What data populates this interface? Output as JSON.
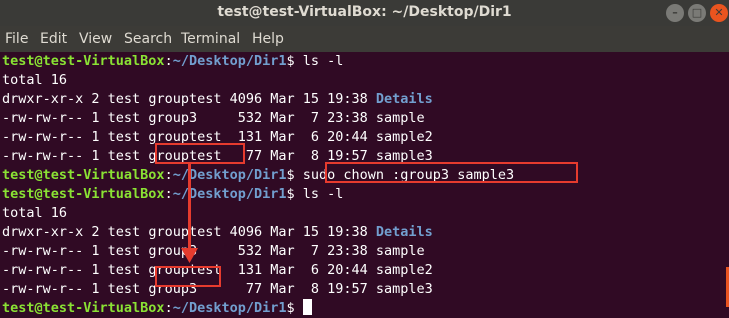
{
  "window": {
    "title": "test@test-VirtualBox: ~/Desktop/Dir1",
    "min_glyph": "–",
    "max_glyph": "□",
    "close_glyph": "✕"
  },
  "menu": [
    "File",
    "Edit",
    "View",
    "Search",
    "Terminal",
    "Help"
  ],
  "prompt": {
    "user": "test@test-VirtualBox",
    "sep": ":",
    "path": "~/Desktop/Dir1",
    "symbol": "$ "
  },
  "commands": {
    "ls1": "ls -l",
    "chown": "sudo chown :group3 sample3",
    "ls2": "ls -l"
  },
  "listing1": {
    "total": "total 16",
    "rows": [
      {
        "prefix": "drwxr-xr-x 2 test ",
        "group": "grouptest",
        "rest": " 4096 Mar 15 19:38 ",
        "name": "Details"
      },
      {
        "prefix": "-rw-rw-r-- 1 test ",
        "group": "group3   ",
        "rest": "  532 Mar  7 23:38 ",
        "name": "sample"
      },
      {
        "prefix": "-rw-rw-r-- 1 test ",
        "group": "grouptest",
        "rest": "  131 Mar  6 20:44 ",
        "name": "sample2"
      },
      {
        "prefix": "-rw-rw-r-- 1 test ",
        "group": "grouptest",
        "rest": "   77 Mar  8 19:57 ",
        "name": "sample3"
      }
    ]
  },
  "listing2": {
    "total": "total 16",
    "rows": [
      {
        "prefix": "drwxr-xr-x 2 test ",
        "group": "grouptest",
        "rest": " 4096 Mar 15 19:38 ",
        "name": "Details"
      },
      {
        "prefix": "-rw-rw-r-- 1 test ",
        "group": "group3   ",
        "rest": "  532 Mar  7 23:38 ",
        "name": "sample"
      },
      {
        "prefix": "-rw-rw-r-- 1 test ",
        "group": "grouptest",
        "rest": "  131 Mar  6 20:44 ",
        "name": "sample2"
      },
      {
        "prefix": "-rw-rw-r-- 1 test ",
        "group": "group3   ",
        "rest": "   77 Mar  8 19:57 ",
        "name": "sample3"
      }
    ]
  },
  "colors": {
    "background": "#300a24",
    "prompt_user": "#8ae234",
    "prompt_path": "#729fcf",
    "highlight": "#e63b2e"
  }
}
